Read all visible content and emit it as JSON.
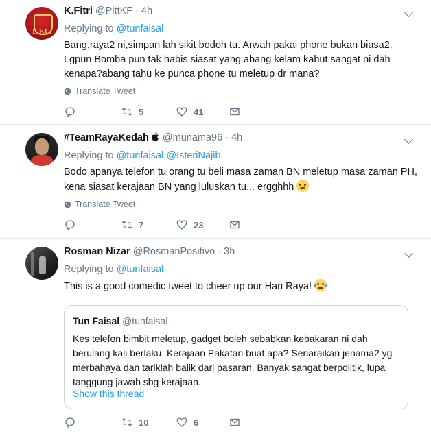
{
  "tweets": [
    {
      "name": "K.Fitri",
      "handle": "@PittKF",
      "dot": "·",
      "time": "4h",
      "replying_prefix": "Replying to",
      "replying_to": "@tunfaisal",
      "lines": [
        "Bang,raya2 ni,simpan lah sikit bodoh tu. Arwah pakai phone bukan biasa2.",
        "Lgpun Bomba pun tak habis siasat,yang abang kelam kabut sangat ni dah",
        "kenapa?abang tahu ke punca phone tu meletup dr mana?"
      ],
      "translate": "Translate Tweet",
      "retweets": "5",
      "likes": "41"
    },
    {
      "name": "#TeamRayaKedah",
      "handle": "@munama96",
      "dot": "·",
      "time": "4h",
      "replying_prefix": "Replying to",
      "replying_to": "@tunfaisal",
      "replying_to_2": "@IsteriNajib",
      "lines": [
        "Bodo apanya telefon tu orang tu beli masa zaman BN meletup masa zaman PH,",
        "kena siasat kerajaan BN yang luluskan tu... ergghhh"
      ],
      "translate": "Translate Tweet",
      "retweets": "7",
      "likes": "23"
    },
    {
      "name": "Rosman Nizar",
      "handle": "@RosmanPositivo",
      "dot": "·",
      "time": "3h",
      "replying_prefix": "Replying to",
      "replying_to": "@tunfaisal",
      "lines": [
        "This is a good comedic tweet to cheer up our Hari Raya!"
      ],
      "retweets": "10",
      "likes": "6",
      "quote": {
        "name": "Tun Faisal",
        "handle": "@tunfaisal",
        "lines": [
          "Kes telefon bimbit meletup, gadget boleh sebabkan kebakaran ni dah",
          "berulang kali berlaku. Kerajaan Pakatan buat apa? Senaraikan jenama2 yg",
          "merbahaya dan tariklah balik dari pasaran. Banyak sangat berpolitik, lupa",
          "tanggung jawab sbg kerajaan."
        ],
        "show_thread": "Show this thread"
      }
    }
  ],
  "colors": {
    "accent": "#1da1f2",
    "muted": "#657786",
    "text": "#14171a",
    "border": "#e6ecf0"
  },
  "icons": [
    "reply-icon",
    "retweet-icon",
    "like-icon",
    "dm-icon",
    "globe-icon",
    "apple-icon",
    "caret-down-icon"
  ]
}
